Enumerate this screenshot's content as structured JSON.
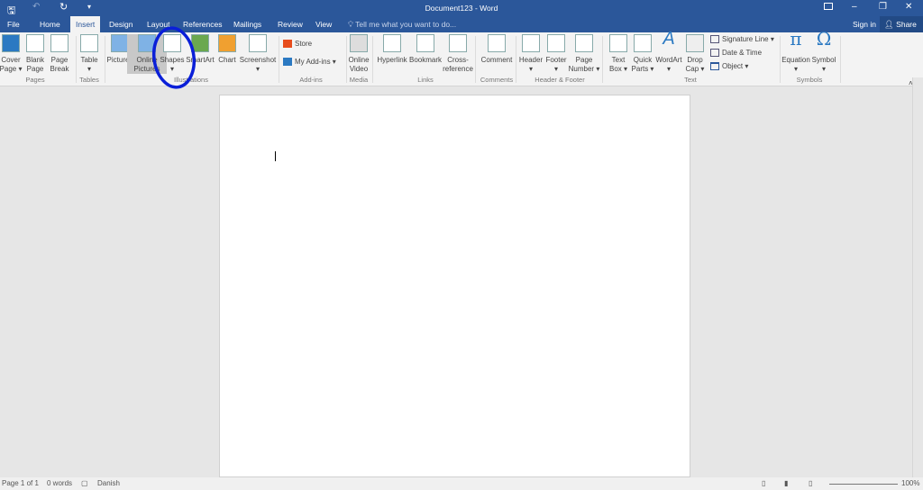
{
  "title": "Document123 - Word",
  "qat": {
    "save": "save-icon",
    "undo": "undo-icon",
    "redo": "redo-icon",
    "customize": "▾"
  },
  "window": {
    "ribbon_display": "ribbon-display-icon",
    "minimize": "–",
    "restore": "❐",
    "close": "✕"
  },
  "tabs": [
    "File",
    "Home",
    "Insert",
    "Design",
    "Layout",
    "References",
    "Mailings",
    "Review",
    "View"
  ],
  "active_tab": "Insert",
  "tell_me": "Tell me what you want to do...",
  "sign_in": "Sign in",
  "share": "Share",
  "ribbon": {
    "buttons": [
      {
        "id": "cover-page",
        "l1": "Cover",
        "l2": "Page ▾",
        "color": "#2b79c2"
      },
      {
        "id": "blank-page",
        "l1": "Blank",
        "l2": "Page",
        "color": "#ffffff"
      },
      {
        "id": "page-break",
        "l1": "Page",
        "l2": "Break",
        "color": "#ffffff"
      },
      {
        "id": "table",
        "l1": "Table",
        "l2": "▾",
        "color": "#ffffff"
      },
      {
        "id": "pictures",
        "l1": "Pictures",
        "l2": "",
        "color": "#7fb2e5"
      },
      {
        "id": "online-pictures",
        "l1": "Online",
        "l2": "Pictures",
        "color": "#7fb2e5"
      },
      {
        "id": "shapes",
        "l1": "Shapes",
        "l2": "▾",
        "color": "#ffffff"
      },
      {
        "id": "smartart",
        "l1": "SmartArt",
        "l2": "",
        "color": "#6aa84f"
      },
      {
        "id": "chart",
        "l1": "Chart",
        "l2": "",
        "color": "#f0a030"
      },
      {
        "id": "screenshot",
        "l1": "Screenshot",
        "l2": "▾",
        "color": "#ffffff"
      },
      {
        "id": "online-video",
        "l1": "Online",
        "l2": "Video",
        "color": "#dddddd"
      },
      {
        "id": "hyperlink",
        "l1": "Hyperlink",
        "l2": "",
        "color": "#ffffff"
      },
      {
        "id": "bookmark",
        "l1": "Bookmark",
        "l2": "",
        "color": "#ffffff"
      },
      {
        "id": "cross-reference",
        "l1": "Cross-",
        "l2": "reference",
        "color": "#ffffff"
      },
      {
        "id": "comment",
        "l1": "Comment",
        "l2": "",
        "color": "#ffffff"
      },
      {
        "id": "header",
        "l1": "Header",
        "l2": "▾",
        "color": "#ffffff"
      },
      {
        "id": "footer",
        "l1": "Footer",
        "l2": "▾",
        "color": "#ffffff"
      },
      {
        "id": "page-number",
        "l1": "Page",
        "l2": "Number ▾",
        "color": "#ffffff"
      },
      {
        "id": "text-box",
        "l1": "Text",
        "l2": "Box ▾",
        "color": "#ffffff"
      },
      {
        "id": "quick-parts",
        "l1": "Quick",
        "l2": "Parts ▾",
        "color": "#ffffff"
      },
      {
        "id": "wordart",
        "l1": "WordArt",
        "l2": "▾",
        "color": "#ffffff"
      },
      {
        "id": "drop-cap",
        "l1": "Drop",
        "l2": "Cap ▾",
        "color": "#eeeeee"
      },
      {
        "id": "equation",
        "l1": "Equation",
        "l2": "▾",
        "color": "#ffffff"
      },
      {
        "id": "symbol",
        "l1": "Symbol",
        "l2": "▾",
        "color": "#ffffff"
      }
    ],
    "store": "Store",
    "my_addins": "My Add-ins",
    "signature_line": "Signature Line",
    "date_time": "Date & Time",
    "object": "Object",
    "groups": [
      "Pages",
      "Tables",
      "Illustrations",
      "Add-ins",
      "Media",
      "Links",
      "Comments",
      "Header & Footer",
      "Text",
      "Symbols"
    ],
    "selected": "online-pictures"
  },
  "annotation": {
    "color": "#0a1fd8",
    "target": "shapes"
  },
  "status": {
    "page": "Page 1 of 1",
    "words": "0 words",
    "language": "Danish",
    "zoom": "100%"
  }
}
